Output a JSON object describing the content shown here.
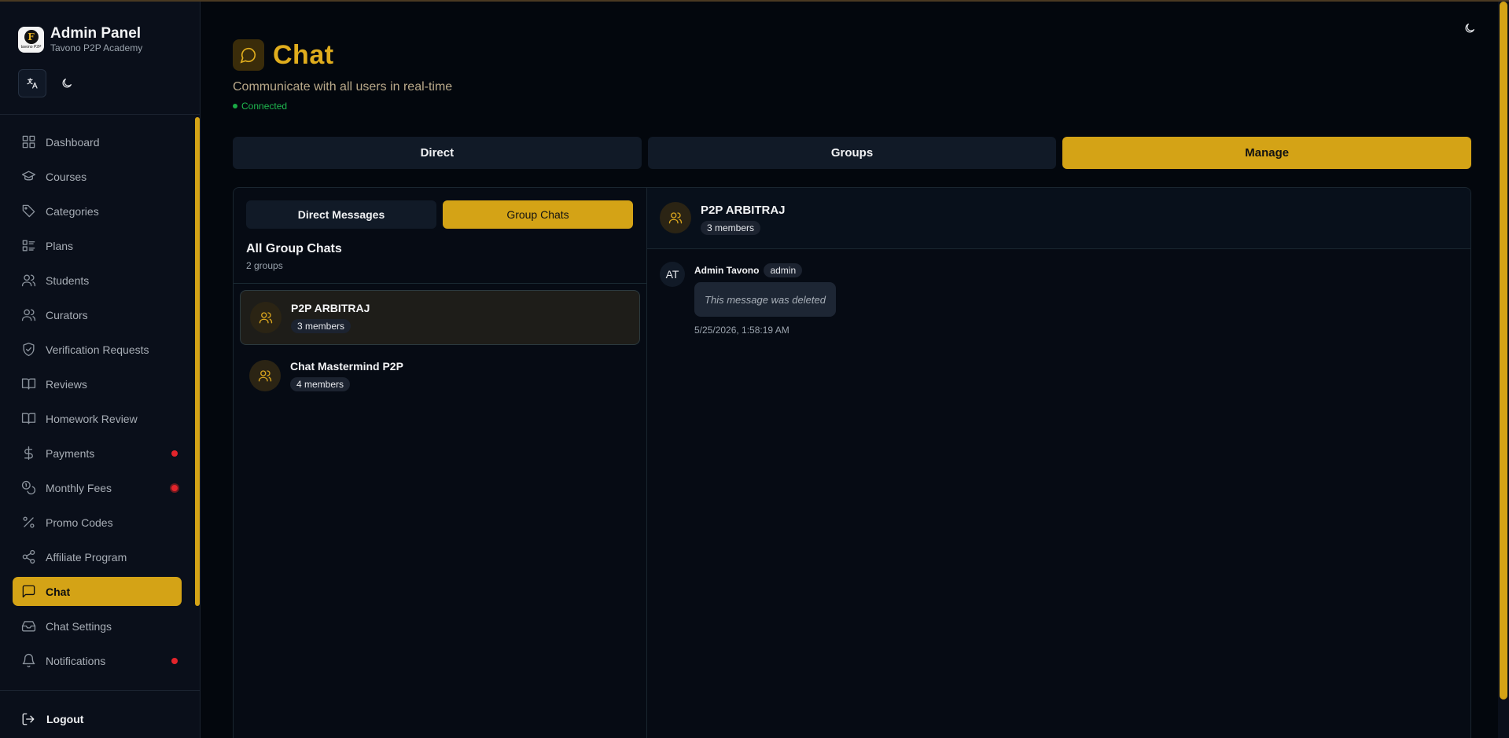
{
  "sidebar": {
    "brand_title": "Admin Panel",
    "brand_sub": "Tavono P2P Academy",
    "logo_mark": "F",
    "logo_word": "tavono P2P",
    "items": [
      {
        "label": "Dashboard",
        "icon": "dashboard-icon"
      },
      {
        "label": "Courses",
        "icon": "graduation-cap-icon"
      },
      {
        "label": "Categories",
        "icon": "tag-icon"
      },
      {
        "label": "Plans",
        "icon": "list-icon"
      },
      {
        "label": "Students",
        "icon": "users-icon"
      },
      {
        "label": "Curators",
        "icon": "users-icon"
      },
      {
        "label": "Verification Requests",
        "icon": "shield-check-icon"
      },
      {
        "label": "Reviews",
        "icon": "book-open-icon"
      },
      {
        "label": "Homework Review",
        "icon": "book-open-icon"
      },
      {
        "label": "Payments",
        "icon": "dollar-icon",
        "notification": true
      },
      {
        "label": "Monthly Fees",
        "icon": "coins-icon",
        "notification": true
      },
      {
        "label": "Promo Codes",
        "icon": "percent-icon"
      },
      {
        "label": "Affiliate Program",
        "icon": "share-icon"
      },
      {
        "label": "Chat",
        "icon": "message-square-icon",
        "active": true
      },
      {
        "label": "Chat Settings",
        "icon": "inbox-icon"
      },
      {
        "label": "Notifications",
        "icon": "bell-icon",
        "notification": true
      }
    ],
    "logout_label": "Logout"
  },
  "header": {
    "title": "Chat",
    "subtitle": "Communicate with all users in real-time",
    "status": "Connected"
  },
  "tabs": [
    "Direct",
    "Groups",
    "Manage"
  ],
  "subtabs": [
    "Direct Messages",
    "Group Chats"
  ],
  "group_list": {
    "title": "All Group Chats",
    "count": "2 groups",
    "groups": [
      {
        "name": "P2P ARBITRAJ",
        "members": "3 members"
      },
      {
        "name": "Chat Mastermind P2P",
        "members": "4 members"
      }
    ]
  },
  "chat": {
    "name": "P2P ARBITRAJ",
    "members": "3 members",
    "message": {
      "avatar": "AT",
      "author": "Admin Tavono",
      "role": "admin",
      "text": "This message was deleted",
      "time": "5/25/2026, 1:58:19 AM"
    }
  },
  "colors": {
    "accent": "#d4a316",
    "background": "#03070d",
    "connected": "#1fb84f",
    "alert": "#e3242b"
  }
}
